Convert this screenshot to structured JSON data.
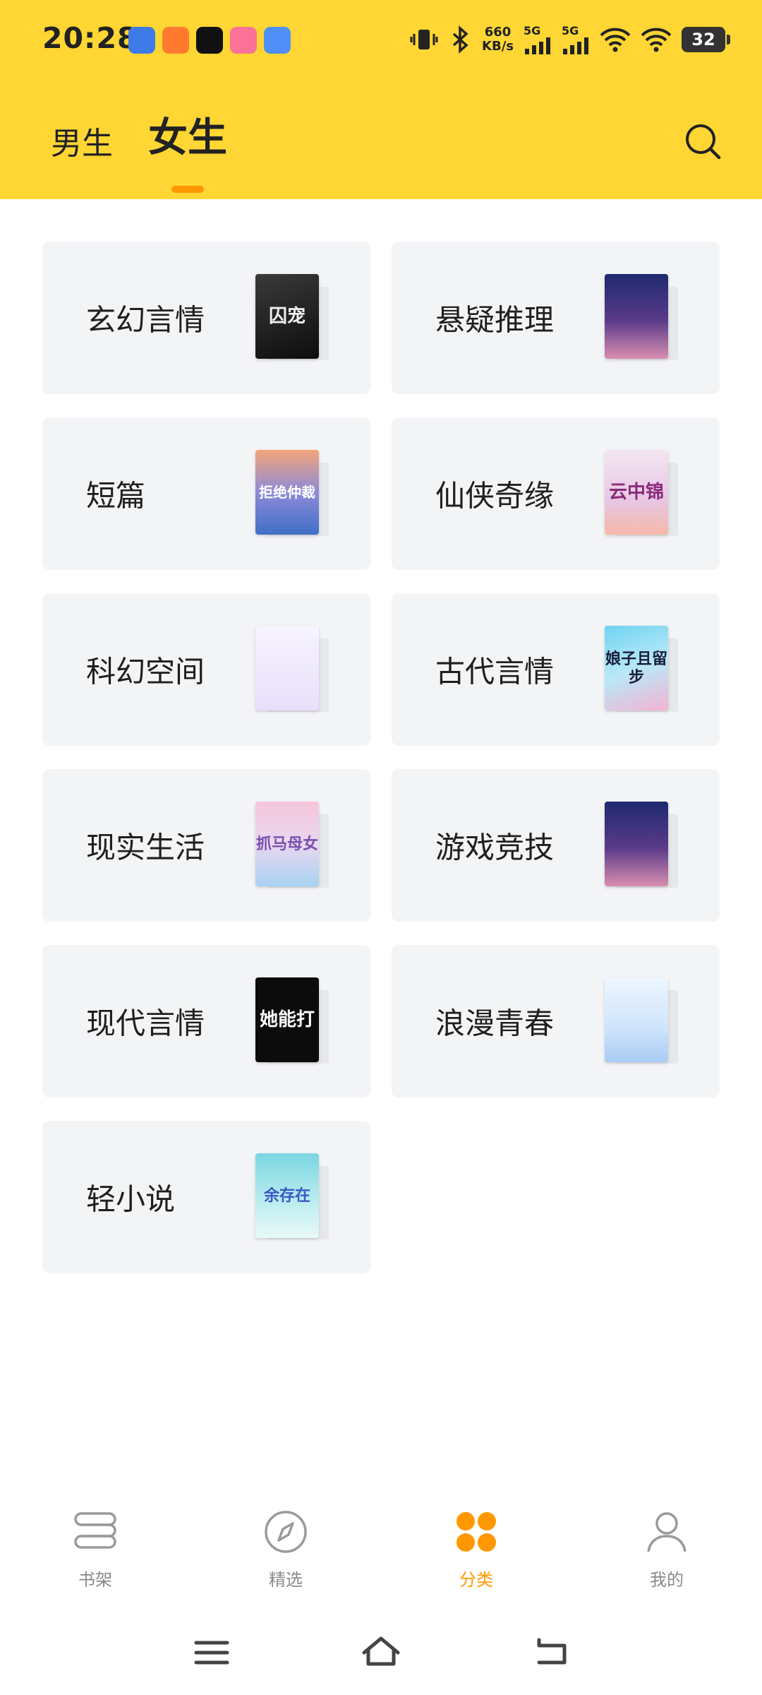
{
  "status": {
    "time": "20:28",
    "net_speed_value": "660",
    "net_speed_unit": "KB/s",
    "signal_1": "5G",
    "signal_2": "5G",
    "battery": "32"
  },
  "header": {
    "tabs": [
      {
        "label": "男生",
        "active": false
      },
      {
        "label": "女生",
        "active": true
      }
    ],
    "accent_color": "#ffd633",
    "indicator_color": "#ff9800"
  },
  "categories": [
    {
      "label": "玄幻言情",
      "cover_text": "囚宠"
    },
    {
      "label": "悬疑推理",
      "cover_text": ""
    },
    {
      "label": "短篇",
      "cover_text": "拒绝仲裁"
    },
    {
      "label": "仙侠奇缘",
      "cover_text": "云中锦"
    },
    {
      "label": "科幻空间",
      "cover_text": ""
    },
    {
      "label": "古代言情",
      "cover_text": "娘子且留步"
    },
    {
      "label": "现实生活",
      "cover_text": "抓马母女"
    },
    {
      "label": "游戏竞技",
      "cover_text": ""
    },
    {
      "label": "现代言情",
      "cover_text": "她能打"
    },
    {
      "label": "浪漫青春",
      "cover_text": ""
    },
    {
      "label": "轻小说",
      "cover_text": "余存在"
    }
  ],
  "bottom_nav": [
    {
      "label": "书架",
      "icon": "bookshelf-icon",
      "active": false
    },
    {
      "label": "精选",
      "icon": "compass-icon",
      "active": false
    },
    {
      "label": "分类",
      "icon": "category-icon",
      "active": true
    },
    {
      "label": "我的",
      "icon": "profile-icon",
      "active": false
    }
  ]
}
